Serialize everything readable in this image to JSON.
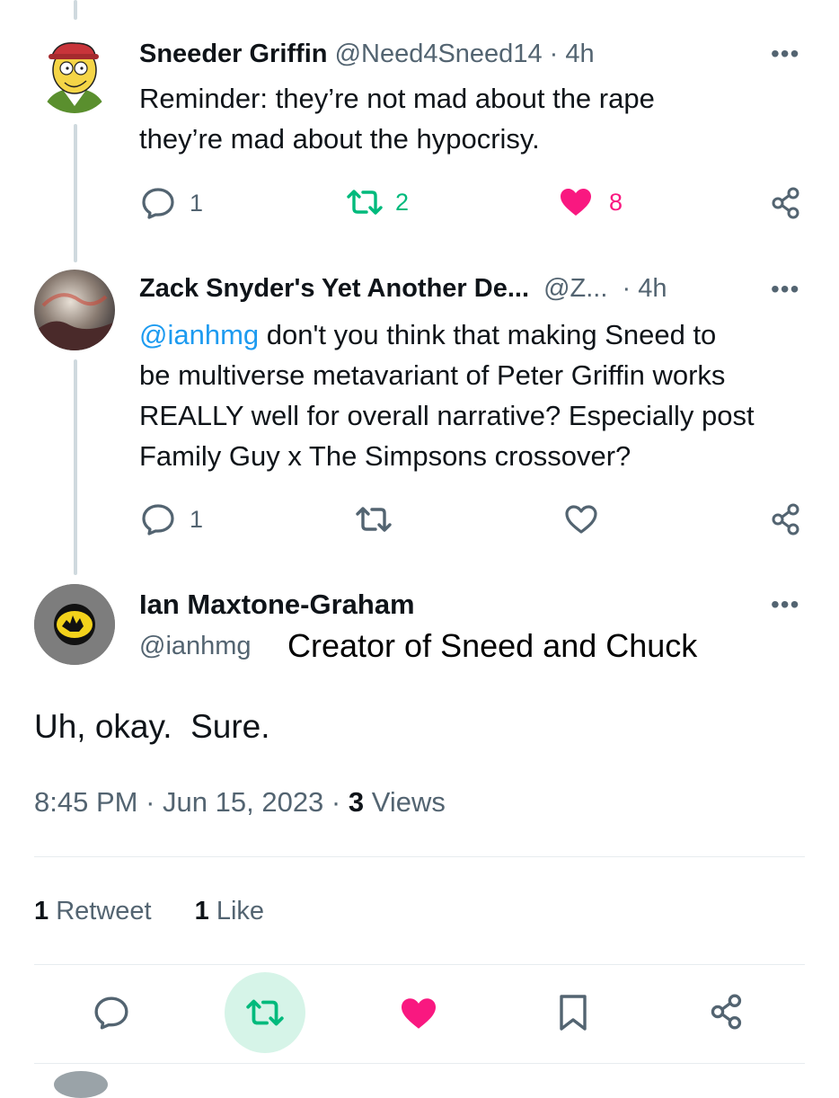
{
  "colors": {
    "like": "#f91880",
    "retweet": "#00ba7c",
    "link": "#1d9bf0",
    "muted": "#536471"
  },
  "tweets": [
    {
      "name": "Sneeder Griffin",
      "handle": "@Need4Sneed14",
      "sep": "·",
      "time": "4h",
      "text_lines": [
        "Reminder: they’re not mad about the rape",
        "they’re mad about the hypocrisy."
      ],
      "replies": "1",
      "retweets": "2",
      "likes": "8",
      "more": "•••"
    },
    {
      "name": "Zack Snyder's Yet Another De...",
      "handle": "@Z...",
      "sep": "·",
      "time": "4h",
      "mention": "@ianhmg",
      "text_first": " don't you think that making Sneed to",
      "text_lines": [
        "be multiverse metavariant of Peter Griffin works",
        "REALLY well for overall narrative? Especially post",
        "Family Guy x The Simpsons crossover?"
      ],
      "replies": "1",
      "more": "•••"
    }
  ],
  "main": {
    "name": "Ian Maxtone-Graham",
    "handle": "@ianhmg",
    "annotation": "Creator of Sneed and Chuck",
    "text": "Uh, okay.  Sure.",
    "time": "8:45 PM",
    "date": "Jun 15, 2023",
    "sep": "·",
    "views_count": "3",
    "views_label": "Views",
    "retweet_count": "1",
    "retweet_label": "Retweet",
    "like_count": "1",
    "like_label": "Like",
    "more": "•••"
  }
}
